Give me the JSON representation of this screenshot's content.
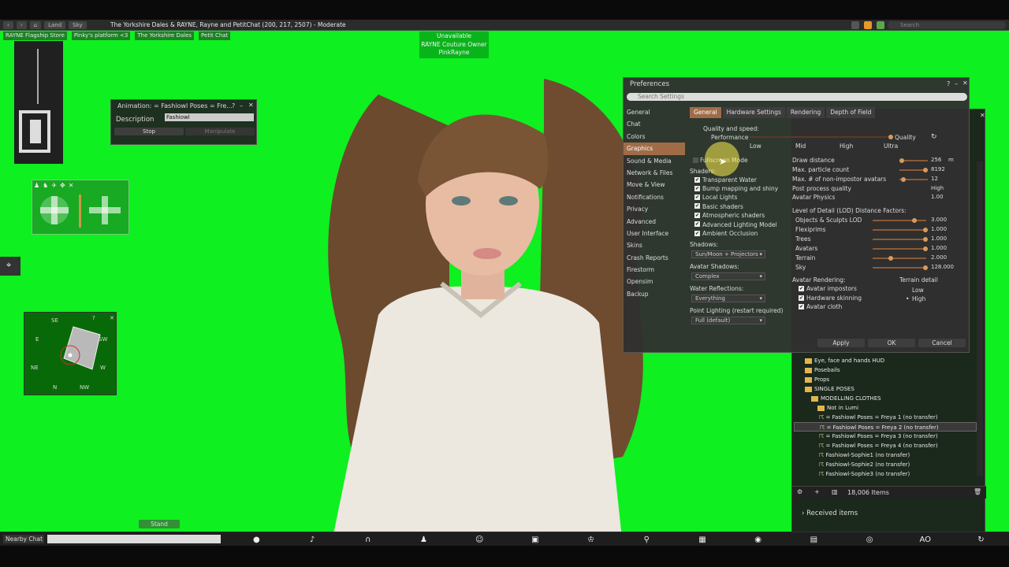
{
  "topbar": {
    "nav": [
      "Land",
      "Sky"
    ],
    "location": "The Yorkshire Dales & RAYNE, Rayne and PetitChat (200, 217, 2507) - Moderate",
    "search_placeholder": "Search"
  },
  "favorites": [
    "RAYNE Flagship Store",
    "Pinky's platform <3",
    "The Yorkshire Dales",
    "Petit Chat"
  ],
  "nametag": {
    "line1": "Unavailable",
    "line2": "RAYNE Couture Owner",
    "line3": "PinkRayne"
  },
  "animation": {
    "title": "Animation: = Fashiowl Poses = Fre...",
    "description_label": "Description",
    "description_value": "Fashiowl",
    "stop": "Stop",
    "manipulate": "Manipulate"
  },
  "minimap": {
    "se": "SE",
    "e": "E",
    "ne": "NE",
    "n": "N",
    "nw": "NW",
    "sw": "SW",
    "w": "W"
  },
  "preferences": {
    "title": "Preferences",
    "search_placeholder": "Search Settings",
    "categories": [
      "General",
      "Chat",
      "Colors",
      "Graphics",
      "Sound & Media",
      "Network & Files",
      "Move & View",
      "Notifications",
      "Privacy",
      "Advanced",
      "User Interface",
      "Skins",
      "Crash Reports",
      "Firestorm",
      "Opensim",
      "Backup"
    ],
    "selected_category": "Graphics",
    "tabs": [
      "General",
      "Hardware Settings",
      "Rendering",
      "Depth of Field"
    ],
    "quality_label": "Quality and speed:",
    "performance": "Performance",
    "quality": "Quality",
    "levels": [
      "Low",
      "Mid",
      "High",
      "Ultra"
    ],
    "fullscreen": "Fullscreen Mode",
    "shaders_label": "Shaders:",
    "shaders": [
      "Transparent Water",
      "Bump mapping and shiny",
      "Local Lights",
      "Basic shaders",
      "Atmospheric shaders",
      "Advanced Lighting Model",
      "Ambient Occlusion"
    ],
    "shadows_label": "Shadows:",
    "shadows_value": "Sun/Moon + Projectors",
    "avatar_shadows_label": "Avatar Shadows:",
    "avatar_shadows_value": "Complex",
    "water_label": "Water Reflections:",
    "water_value": "Everything",
    "point_label": "Point Lighting (restart required)",
    "point_value": "Full (default)",
    "right_settings": [
      {
        "label": "Draw distance",
        "value": "256",
        "unit": "m"
      },
      {
        "label": "Max. particle count",
        "value": "8192"
      },
      {
        "label": "Max. # of non-impostor avatars",
        "value": "12"
      },
      {
        "label": "Post process quality",
        "value": "High"
      },
      {
        "label": "Avatar Physics",
        "value": "1.00"
      }
    ],
    "lod_label": "Level of Detail (LOD) Distance Factors:",
    "lod": [
      {
        "label": "Objects & Sculpts LOD",
        "value": "3.000"
      },
      {
        "label": "Flexiprims",
        "value": "1.000"
      },
      {
        "label": "Trees",
        "value": "1.000"
      },
      {
        "label": "Avatars",
        "value": "1.000"
      },
      {
        "label": "Terrain",
        "value": "2.000"
      },
      {
        "label": "Sky",
        "value": "128.000"
      }
    ],
    "avatar_rendering_label": "Avatar Rendering:",
    "avatar_rendering": [
      "Avatar impostors",
      "Hardware skinning",
      "Avatar cloth"
    ],
    "terrain_detail_label": "Terrain detail",
    "terrain_low": "Low",
    "terrain_high": "High",
    "apply": "Apply",
    "ok": "OK",
    "cancel": "Cancel"
  },
  "inventory": {
    "rows": [
      {
        "text": "Eye, face and hands HUD",
        "folder": true
      },
      {
        "text": "Posebails",
        "folder": true
      },
      {
        "text": "Props",
        "folder": true
      },
      {
        "text": "SINGLE POSES",
        "folder": true
      },
      {
        "text": "MODELLING CLOTHES",
        "folder": true
      },
      {
        "text": "Not in Lumi",
        "folder": true
      },
      {
        "text": "= Fashiowl Poses = Freya 1 (no transfer)",
        "folder": false
      },
      {
        "text": "= Fashiowl Poses = Freya 2 (no transfer)",
        "folder": false
      },
      {
        "text": "= Fashiowl Poses = Freya 3 (no transfer)",
        "folder": false
      },
      {
        "text": "= Fashiowl Poses = Freya 4 (no transfer)",
        "folder": false
      },
      {
        "text": "Fashiowl-Sophie1 (no transfer)",
        "folder": false
      },
      {
        "text": "Fashiowl-Sophie2 (no transfer)",
        "folder": false
      },
      {
        "text": "Fashiowl-Sophie3 (no transfer)",
        "folder": false
      }
    ],
    "count": "18,006 Items",
    "received": "Received items"
  },
  "chatbar": {
    "nearby": "Nearby Chat",
    "stand": "Stand",
    "ao": "AO"
  },
  "colors": {
    "background": "#0ef01f",
    "accent": "#a06c48"
  }
}
